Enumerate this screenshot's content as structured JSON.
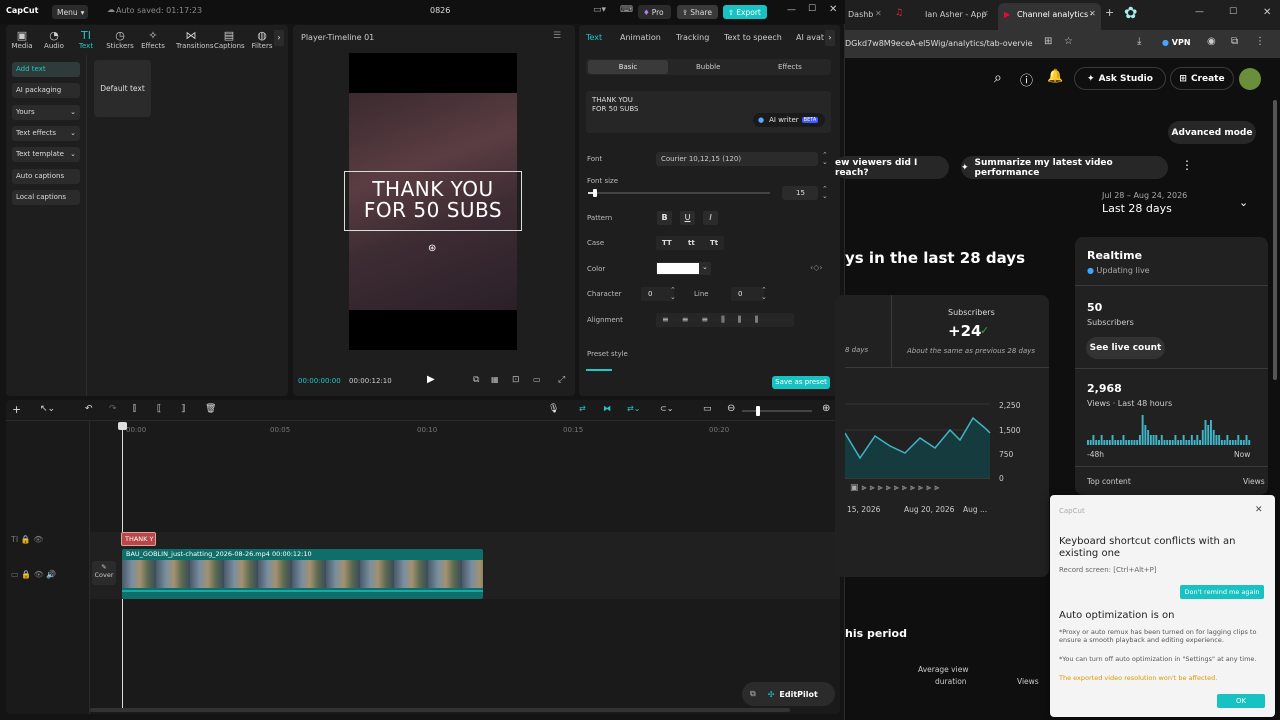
{
  "capcut": {
    "logo": "CapCut",
    "menu": "Menu",
    "autosave": "Auto saved: 01:17:23",
    "project": "0826",
    "pro": "Pro",
    "share": "Share",
    "export": "Export",
    "tools": [
      "Media",
      "Audio",
      "Text",
      "Stickers",
      "Effects",
      "Transitions",
      "Captions",
      "Filters"
    ],
    "left_items": [
      "Add text",
      "AI packaging",
      "Yours",
      "Text effects",
      "Text template",
      "Auto captions",
      "Local captions"
    ],
    "default_text": "Default text",
    "player": {
      "title": "Player-Timeline 01",
      "overlay_line1": "THANK YOU",
      "overlay_line2": "FOR 50 SUBS",
      "time_current": "00:00:00:00",
      "time_total": "00:00:12:10"
    },
    "props": {
      "tabs": [
        "Text",
        "Animation",
        "Tracking",
        "Text to speech",
        "AI avat"
      ],
      "subtabs": [
        "Basic",
        "Bubble",
        "Effects"
      ],
      "text_line1": "THANK YOU",
      "text_line2": "FOR 50 SUBS",
      "ai_writer": "AI writer",
      "beta": "BETA",
      "font_label": "Font",
      "font_value": "Courier 10,12,15 (120)",
      "font_size_label": "Font size",
      "font_size_value": "15",
      "font_size_fraction": 0.03,
      "pattern_label": "Pattern",
      "case_label": "Case",
      "case_opts": [
        "TT",
        "tt",
        "Tt"
      ],
      "color_label": "Color",
      "color_value": "#ffffff",
      "character_label": "Character",
      "character_value": "0",
      "line_label": "Line",
      "line_value": "0",
      "alignment_label": "Alignment",
      "preset_label": "Preset style",
      "save_preset": "Save as preset"
    },
    "timeline": {
      "ticks": [
        "00:00",
        "00:05",
        "00:10",
        "00:15",
        "00:20"
      ],
      "text_clip": "THANK Y",
      "cover": "Cover",
      "video_clip": "BAU_GOBLIN_just-chatting_2026-08-26.mp4",
      "video_duration": "00:00:12:10",
      "editpilot": "EditPilot"
    }
  },
  "browser": {
    "tabs": [
      "Dashb",
      "Ian Asher - App",
      "Channel analytics -"
    ],
    "url": "DGkd7w8M9eceA-el5Wig/analytics/tab-overvie",
    "vpn": "VPN",
    "ask_studio": "Ask Studio",
    "create": "Create",
    "advanced_mode": "Advanced mode",
    "chip1": "ew viewers did I reach?",
    "chip2": "Summarize my latest video performance",
    "date_range": "Jul 28 – Aug 24, 2026",
    "date_label": "Last 28 days",
    "heading": "ys in the last 28 days",
    "subs_label": "Subscribers",
    "subs_value": "+24",
    "subs_note": "About the same as previous 28 days",
    "views_note": "8 days",
    "chart_y": [
      "2,250",
      "1,500",
      "750",
      "0"
    ],
    "chart_x": [
      "15, 2026",
      "Aug 20, 2026",
      "Aug ..."
    ],
    "period": "his period",
    "avg_view_1": "Average view",
    "avg_view_2": "duration",
    "views_col": "Views",
    "realtime": {
      "title": "Realtime",
      "updating": "Updating live",
      "subs_count": "50",
      "subs_label": "Subscribers",
      "see_live": "See live count",
      "views_count": "2,968",
      "views_label": "Views · Last 48 hours",
      "x_start": "-48h",
      "x_end": "Now",
      "top_content": "Top content",
      "views": "Views"
    }
  },
  "notification": {
    "app": "CapCut",
    "title": "Keyboard shortcut conflicts with an existing one",
    "shortcut": "Record screen: [Ctrl+Alt+P]",
    "dont_remind": "Don't remind me again",
    "title2": "Auto optimization is on",
    "body1": "*Proxy or auto remux has been turned on for lagging clips to ensure a smooth playback and editing experience.",
    "body2": "*You can turn off auto optimization in \"Settings\" at any time.",
    "warning": "The exported video resolution won't be affected.",
    "ok": "OK"
  },
  "colors": {
    "accent": "#1ec8c8",
    "export": "#19c2c2",
    "teal": "#0e8a87",
    "clip_red": "#b84848",
    "yt_red": "#ff0033"
  }
}
